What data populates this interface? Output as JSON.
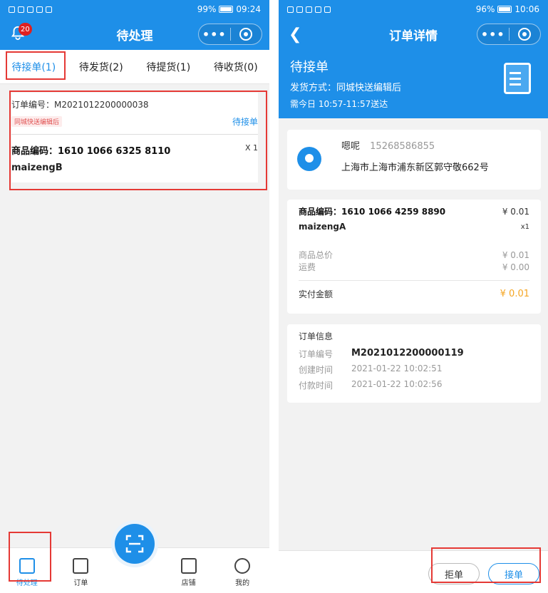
{
  "left": {
    "status_bar": {
      "battery": "99%",
      "time": "09:24",
      "battery_level": 0.99
    },
    "title": "待处理",
    "notification_count": "20",
    "tabs": [
      {
        "label": "待接单(1)",
        "active": true
      },
      {
        "label": "待发货(2)",
        "active": false
      },
      {
        "label": "待提货(1)",
        "active": false
      },
      {
        "label": "待收货(0)",
        "active": false
      }
    ],
    "order": {
      "number": "订单编号：M2021012200000038",
      "delivery_tag": "同城快送编辑后",
      "status": "待接单",
      "product_code": "商品编码：1610 1066 6325 8110",
      "product_name": "maizengB",
      "quantity": "X 1"
    },
    "tabbar": [
      {
        "label": "待处理",
        "icon": "pending-icon",
        "active": true
      },
      {
        "label": "订单",
        "icon": "order-icon",
        "active": false
      },
      {
        "label": "店铺",
        "icon": "shop-icon",
        "active": false
      },
      {
        "label": "我的",
        "icon": "user-icon",
        "active": false
      }
    ]
  },
  "right": {
    "status_bar": {
      "battery": "96%",
      "time": "10:06",
      "battery_level": 0.96
    },
    "title": "订单详情",
    "hero": {
      "status": "待接单",
      "delivery": "发货方式：同城快送编辑后",
      "deadline": "需今日 10:57-11:57送达"
    },
    "address": {
      "name": "嗯呢",
      "phone": "15268586855",
      "address": "上海市上海市浦东新区郭守敬662号"
    },
    "goods": {
      "product_code": "商品编码：1610 1066 4259 8890",
      "price": "¥ 0.01",
      "product_name": "maizengA",
      "quantity": "x1",
      "total_label": "商品总价",
      "total_value": "¥ 0.01",
      "freight_label": "运费",
      "freight_value": "¥ 0.00",
      "paid_label": "实付金额",
      "paid_value": "¥ 0.01"
    },
    "order_info": {
      "title": "订单信息",
      "number_label": "订单编号",
      "number_value": "M2021012200000119",
      "created_label": "创建时间",
      "created_value": "2021-01-22 10:02:51",
      "paid_label": "付款时间",
      "paid_value": "2021-01-22 10:02:56"
    },
    "buttons": {
      "reject": "拒单",
      "accept": "接单"
    }
  },
  "colors": {
    "primary": "#1e8fe8",
    "highlight_box": "#e53935",
    "price": "#f5a623",
    "tag": "#e05050"
  }
}
